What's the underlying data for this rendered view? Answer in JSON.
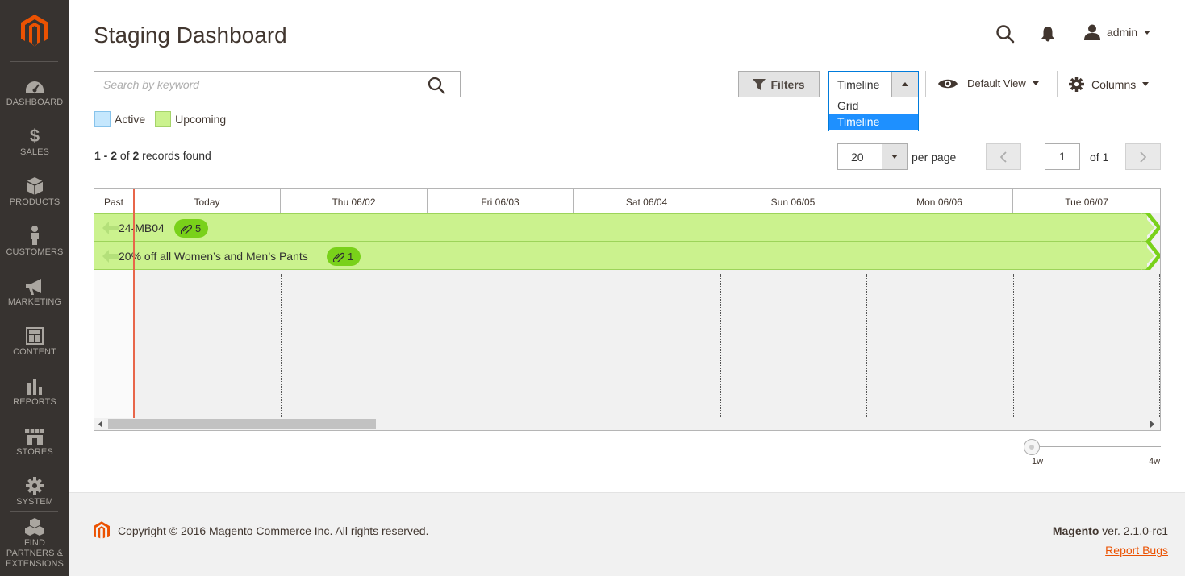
{
  "sidebar": {
    "items": [
      {
        "label": "DASHBOARD",
        "icon": "dashboard-icon"
      },
      {
        "label": "SALES",
        "icon": "dollar-icon"
      },
      {
        "label": "PRODUCTS",
        "icon": "box-icon"
      },
      {
        "label": "CUSTOMERS",
        "icon": "person-icon"
      },
      {
        "label": "MARKETING",
        "icon": "megaphone-icon"
      },
      {
        "label": "CONTENT",
        "icon": "layout-icon"
      },
      {
        "label": "REPORTS",
        "icon": "bar-chart-icon"
      },
      {
        "label": "STORES",
        "icon": "store-icon"
      },
      {
        "label": "SYSTEM",
        "icon": "gear-icon"
      },
      {
        "label": "FIND PARTNERS & EXTENSIONS",
        "icon": "cubes-icon"
      }
    ]
  },
  "header": {
    "title": "Staging Dashboard",
    "user": "admin"
  },
  "toolbar": {
    "search_placeholder": "Search by keyword",
    "filters_label": "Filters",
    "view_selected": "Timeline",
    "view_options": [
      "Grid",
      "Timeline"
    ],
    "default_view_label": "Default View",
    "columns_label": "Columns"
  },
  "legend": {
    "active": "Active",
    "upcoming": "Upcoming"
  },
  "records": {
    "range": "1 - 2",
    "of": "of",
    "total": "2",
    "suffix": "records found"
  },
  "pagination": {
    "per_page": "20",
    "per_page_label": "per page",
    "current_page": "1",
    "of_label": "of 1"
  },
  "timeline": {
    "columns": [
      "Past",
      "Today",
      "Thu 06/02",
      "Fri 06/03",
      "Sat 06/04",
      "Sun 06/05",
      "Mon 06/06",
      "Tue 06/07"
    ],
    "rows": [
      {
        "name": "24-MB04",
        "count": "5",
        "status": "upcoming"
      },
      {
        "name": "20% off all Women’s and Men’s Pants",
        "count": "1",
        "status": "upcoming"
      }
    ]
  },
  "zoom": {
    "min_label": "1w",
    "max_label": "4w",
    "level": 0
  },
  "footer": {
    "copyright": "Copyright © 2016 Magento Commerce Inc. All rights reserved.",
    "brand": "Magento",
    "version": "ver. 2.1.0-rc1",
    "report_bugs": "Report Bugs"
  },
  "colors": {
    "brand": "#eb5202",
    "sidebar": "#373330",
    "upcoming": "#cbf28e",
    "active": "#c5e7fd",
    "selected_option": "#1e90ff",
    "today_line": "#e8664a"
  }
}
